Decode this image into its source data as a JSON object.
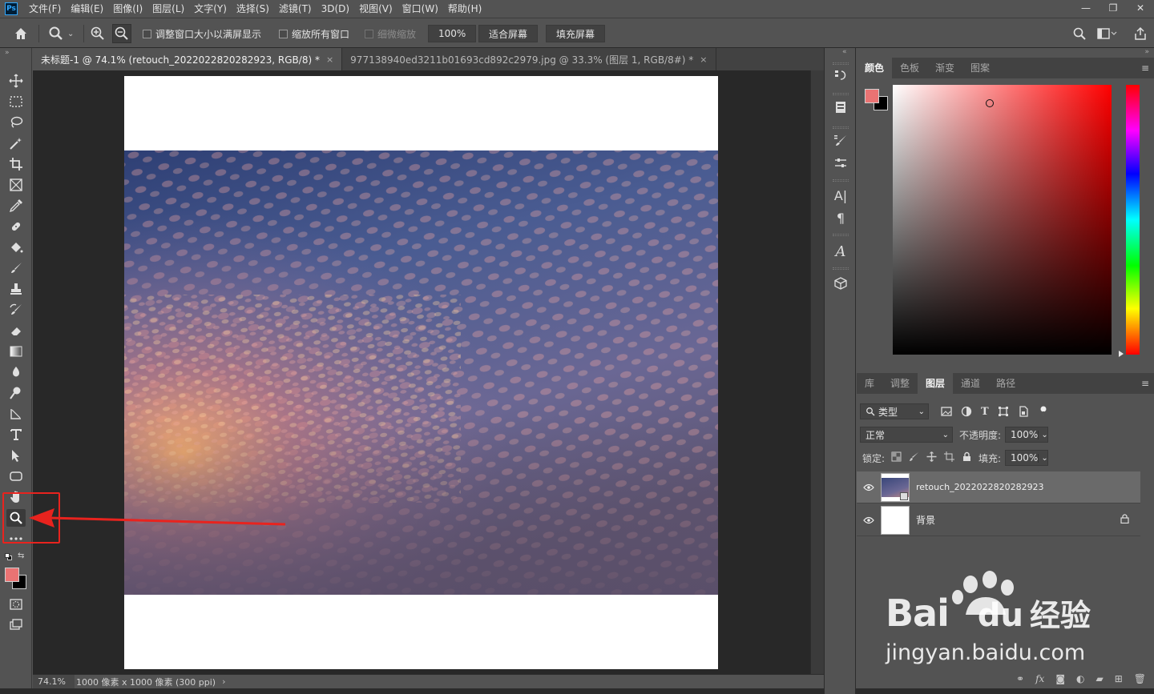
{
  "app": {
    "logo": "Ps"
  },
  "menubar": {
    "items": [
      "文件(F)",
      "编辑(E)",
      "图像(I)",
      "图层(L)",
      "文字(Y)",
      "选择(S)",
      "滤镜(T)",
      "3D(D)",
      "视图(V)",
      "窗口(W)",
      "帮助(H)"
    ],
    "window_controls": [
      "minimize-icon",
      "restore-icon",
      "close-icon"
    ]
  },
  "options": {
    "resize_windows_label": "调整窗口大小以满屏显示",
    "zoom_all_label": "缩放所有窗口",
    "scrubby_zoom_label": "细微缩放",
    "zoom_100": "100%",
    "fit_screen": "适合屏幕",
    "fill_screen": "填充屏幕"
  },
  "tabs": [
    {
      "label": "未标题-1 @ 74.1% (retouch_2022022820282923, RGB/8) *",
      "active": true
    },
    {
      "label": "977138940ed3211b01693cd892c2979.jpg @ 33.3% (图层 1, RGB/8#) *",
      "active": false
    }
  ],
  "status": {
    "zoom": "74.1%",
    "doc_info": "1000 像素 x 1000 像素 (300 ppi)"
  },
  "color_panel": {
    "tabs": [
      "颜色",
      "色板",
      "渐变",
      "图案"
    ],
    "foreground": "#ea7373",
    "background": "#000000"
  },
  "layers_panel": {
    "tabs": [
      "库",
      "调整",
      "图层",
      "通道",
      "路径"
    ],
    "filter_kind": "类型",
    "blend_mode": "正常",
    "opacity_label": "不透明度:",
    "opacity": "100%",
    "lock_label": "锁定:",
    "fill_label": "填充:",
    "fill": "100%",
    "layers": [
      {
        "name": "retouch_2022022820282923",
        "selected": true
      },
      {
        "name": "背景",
        "selected": false,
        "locked": true
      }
    ]
  },
  "watermark": {
    "brand": "Bai",
    "brand2": "du",
    "cn": "经验",
    "url": "jingyan.baidu.com"
  },
  "colors": {
    "accent_red": "#e8231e",
    "panel_bg": "#535353",
    "canvas_bg": "#282828"
  }
}
